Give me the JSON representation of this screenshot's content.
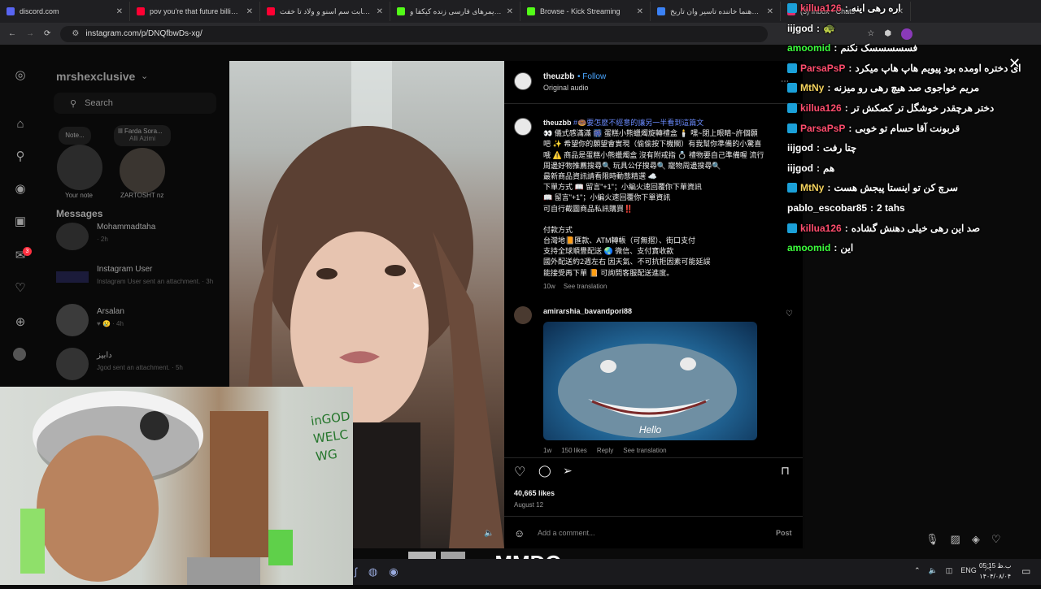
{
  "browser": {
    "tabs": [
      {
        "title": "discord.com",
        "color": "#5865f2"
      },
      {
        "title": "pov you're that future billionaire",
        "color": "#ff0033"
      },
      {
        "title": "از رقابت سم اسنو و ولاد تا خفت",
        "color": "#ff0033"
      },
      {
        "title": "استریمرهای فارسی زنده کیکفا و",
        "color": "#53fc18"
      },
      {
        "title": "Browse - Kick Streaming",
        "color": "#53fc18"
      },
      {
        "title": "بابک رهنما خاننده تاسیر وان تاریخ",
        "color": "#3b82f6"
      },
      {
        "title": "(3) Inbox • Chats",
        "color": "#e1306c"
      }
    ],
    "url": "instagram.com/p/DNQfbwDs-xg/"
  },
  "instagram": {
    "username": "mrshexclusive",
    "search_placeholder": "Search",
    "notes": [
      {
        "bubble": "Note...",
        "label": "Your note"
      },
      {
        "bubble": "Ill Farda Sora...",
        "sub": "Alli Azimi",
        "label": "ZARTOSHT nz"
      }
    ],
    "messages_heading": "Messages",
    "messages": [
      {
        "name": "Mohammadtaha",
        "preview": "· 2h"
      },
      {
        "name": "Instagram User",
        "preview": "Instagram User sent an attachment. · 3h"
      },
      {
        "name": "Arsalan",
        "preview": "♥ 😢 · 4h"
      },
      {
        "name": "دابیز",
        "preview": "Jgod sent an attachment. · 5h"
      }
    ],
    "notification_count": "3"
  },
  "post": {
    "author": "theuzbb",
    "follow_label": "Follow",
    "audio": "Original audio",
    "caption_author": "theuzbb",
    "caption_lines": [
      "#🍩要怎麼不經意的讓另一半看到這篇文",
      "👀 儀式感滿滿 🎆 蛋糕小熊蠟燭旋轉禮盒 🕯️ 嘿~閉上眼睛~許個願",
      "吧 ✨ 希望你的願望會實現（偷偷按下機關）有我幫你準備的小驚喜",
      "哦 ⚠️ 商品是蛋糕小熊蠟燭盒 沒有附戒指 💍 禮物要自己準備喔 流行",
      "周邊好物推薦搜尋🔍 玩具公仔搜尋🔍 寵物周邊搜尋🔍",
      "最新商品資訊請看限時動態精選 ☁️",
      "下單方式 📖 留言\"+1\"；小編火速回覆你下單資訊",
      "📖 留言\"+1\"；小編火速回覆你下單資訊",
      "可自行截圖商品私訊購買‼️",
      "",
      "付款方式",
      "台灣地📙匯款、ATM轉帳（可無摺）、街口支付",
      "支持全球順豐配送 🌏 微信、支付寶收款",
      "國外配送約2週左右 因天氣、不可抗拒因素可能延誤",
      "能接受再下單 📙 可詢問客服配送進度。"
    ],
    "caption_age": "10w",
    "see_translation": "See translation",
    "comment_author": "amirarshia_bavandpori88",
    "gif_caption": "Hello",
    "comment_age": "1w",
    "comment_likes": "150 likes",
    "reply_label": "Reply",
    "likes": "40,665 likes",
    "date": "August 12",
    "add_comment_placeholder": "Add a comment...",
    "post_label": "Post"
  },
  "chat": [
    {
      "user": "killua126",
      "color": "#ff4d6d",
      "text": "اره رهی اینه",
      "badge": true
    },
    {
      "user": "iijgod",
      "color": "#ffffff",
      "text": "🐢",
      "badge": false
    },
    {
      "user": "amoomid",
      "color": "#3cff3c",
      "text": "فسسسسسک نکنم",
      "badge": false
    },
    {
      "user": "ParsaPsP",
      "color": "#ff4d6d",
      "text": "ای دختره اومده بود پیویم هاپ هاپ میکرد",
      "badge": true
    },
    {
      "user": "MtNy",
      "color": "#f4d35e",
      "text": "مریم خواجوی صد هیچ رهی رو میزنه",
      "badge": true
    },
    {
      "user": "killua126",
      "color": "#ff4d6d",
      "text": "دختر هرچقدر خوشگل تر کصکش تر",
      "badge": true
    },
    {
      "user": "ParsaPsP",
      "color": "#ff4d6d",
      "text": "قربونت آقا حسام تو خوبی",
      "badge": true
    },
    {
      "user": "iijgod",
      "color": "#ffffff",
      "text": "چتا رفت",
      "badge": false
    },
    {
      "user": "iijgod",
      "color": "#ffffff",
      "text": "هم",
      "badge": false
    },
    {
      "user": "MtNy",
      "color": "#f4d35e",
      "text": "سرچ کن تو اینستا پیجش هست",
      "badge": true
    },
    {
      "user": "pablo_escobar85",
      "color": "#ffffff",
      "text": "2 tahs",
      "badge": false
    },
    {
      "user": "killua126",
      "color": "#ff4d6d",
      "text": "صد این رهی خیلی دهنش گشاده",
      "badge": true
    },
    {
      "user": "amoomid",
      "color": "#3cff3c",
      "text": "این",
      "badge": false
    }
  ],
  "overlay": {
    "streamer": "yoMMDO",
    "wall_text": "inGOD WELC WG"
  },
  "taskbar": {
    "lang": "ENG",
    "time": "05:15 ب.ظ",
    "date": "۱۴۰۴/۰۸/۰۴"
  }
}
